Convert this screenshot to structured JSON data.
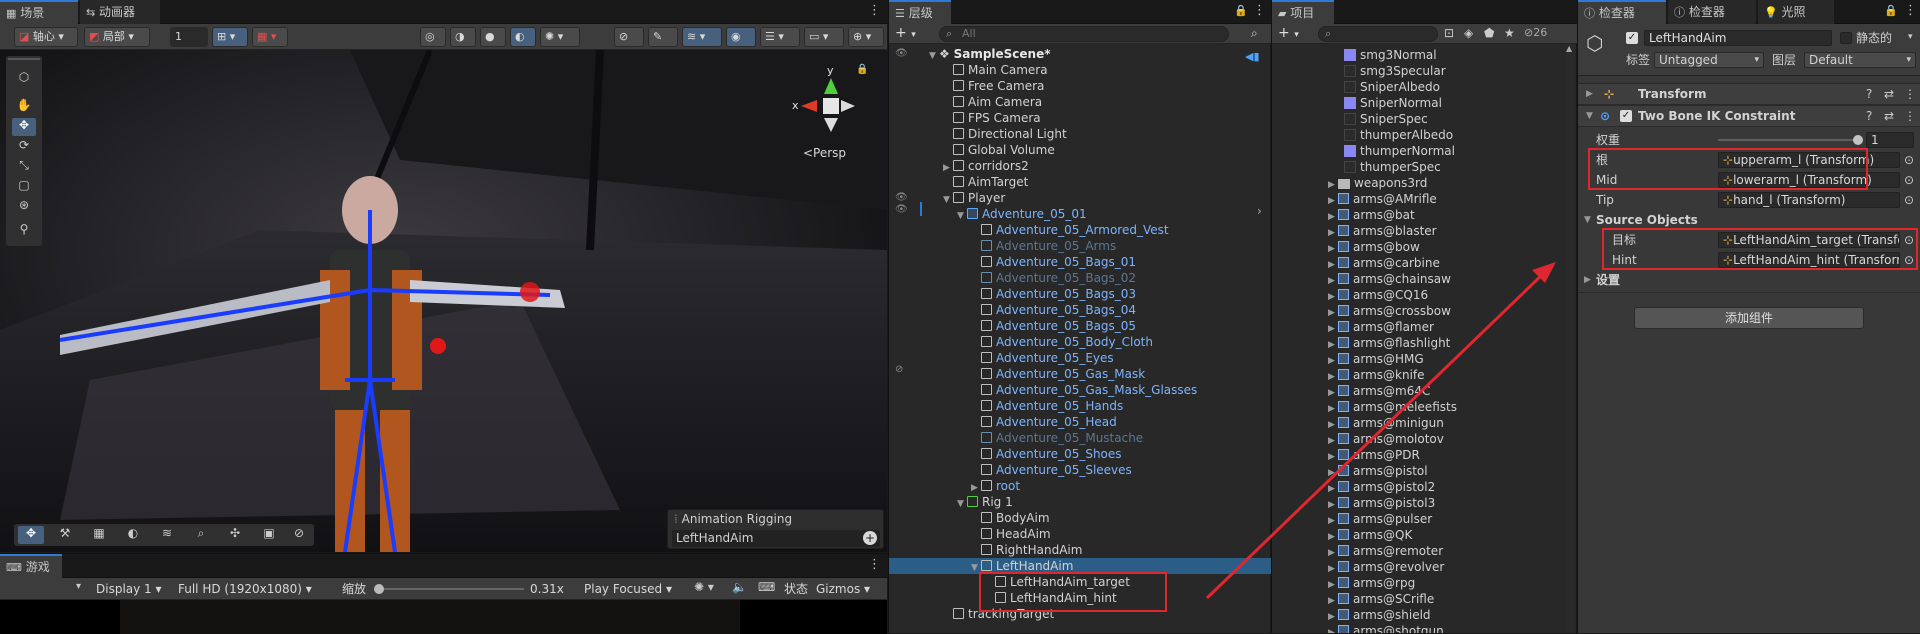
{
  "scene_panel": {
    "tabs": [
      {
        "label": "场景",
        "icon": "scene-grid-icon"
      },
      {
        "label": "动画器",
        "icon": "animator-icon"
      }
    ],
    "toolbar": {
      "pivot_label": "轴心",
      "local_label": "局部",
      "step_value": "1"
    },
    "gizmo": {
      "y_label": "y",
      "x_label": "x",
      "persp_label": "<Persp"
    },
    "overlay": {
      "title": "Animation Rigging",
      "value": "LeftHandAim"
    }
  },
  "game_panel": {
    "tab_label": "游戏",
    "display_label": "Display 1",
    "resolution_label": "Full HD (1920x1080)",
    "scale_label": "缩放",
    "scale_value": "0.31x",
    "play_focus_label": "Play Focused",
    "stats_label": "状态",
    "gizmos_label": "Gizmos"
  },
  "hierarchy": {
    "tab_label": "层级",
    "search_placeholder": "All",
    "rows": [
      {
        "label": "SampleScene*",
        "indent": 0,
        "kind": "scene",
        "arrow": "open"
      },
      {
        "label": "Main Camera",
        "indent": 1,
        "kind": "go"
      },
      {
        "label": "Free Camera",
        "indent": 1,
        "kind": "go"
      },
      {
        "label": "Aim Camera",
        "indent": 1,
        "kind": "go"
      },
      {
        "label": "FPS Camera",
        "indent": 1,
        "kind": "go"
      },
      {
        "label": "Directional Light",
        "indent": 1,
        "kind": "go"
      },
      {
        "label": "Global Volume",
        "indent": 1,
        "kind": "go"
      },
      {
        "label": "corridors2",
        "indent": 1,
        "kind": "go",
        "arrow": "closed"
      },
      {
        "label": "AimTarget",
        "indent": 1,
        "kind": "go"
      },
      {
        "label": "Player",
        "indent": 1,
        "kind": "go",
        "arrow": "open"
      },
      {
        "label": "Adventure_05_01",
        "indent": 2,
        "kind": "prefab",
        "arrow": "open"
      },
      {
        "label": "Adventure_05_Armored_Vest",
        "indent": 3,
        "kind": "prefab-child"
      },
      {
        "label": "Adventure_05_Arms",
        "indent": 3,
        "kind": "prefab-dim"
      },
      {
        "label": "Adventure_05_Bags_01",
        "indent": 3,
        "kind": "prefab-child"
      },
      {
        "label": "Adventure_05_Bags_02",
        "indent": 3,
        "kind": "prefab-dim"
      },
      {
        "label": "Adventure_05_Bags_03",
        "indent": 3,
        "kind": "prefab-child"
      },
      {
        "label": "Adventure_05_Bags_04",
        "indent": 3,
        "kind": "prefab-child"
      },
      {
        "label": "Adventure_05_Bags_05",
        "indent": 3,
        "kind": "prefab-child"
      },
      {
        "label": "Adventure_05_Body_Cloth",
        "indent": 3,
        "kind": "prefab-child"
      },
      {
        "label": "Adventure_05_Eyes",
        "indent": 3,
        "kind": "prefab-child"
      },
      {
        "label": "Adventure_05_Gas_Mask",
        "indent": 3,
        "kind": "prefab-child"
      },
      {
        "label": "Adventure_05_Gas_Mask_Glasses",
        "indent": 3,
        "kind": "prefab-child"
      },
      {
        "label": "Adventure_05_Hands",
        "indent": 3,
        "kind": "prefab-child"
      },
      {
        "label": "Adventure_05_Head",
        "indent": 3,
        "kind": "prefab-child"
      },
      {
        "label": "Adventure_05_Mustache",
        "indent": 3,
        "kind": "prefab-dim"
      },
      {
        "label": "Adventure_05_Shoes",
        "indent": 3,
        "kind": "prefab-child"
      },
      {
        "label": "Adventure_05_Sleeves",
        "indent": 3,
        "kind": "prefab-child"
      },
      {
        "label": "root",
        "indent": 3,
        "kind": "prefab-child",
        "arrow": "closed"
      },
      {
        "label": "Rig 1",
        "indent": 2,
        "kind": "rig",
        "arrow": "open"
      },
      {
        "label": "BodyAim",
        "indent": 3,
        "kind": "go"
      },
      {
        "label": "HeadAim",
        "indent": 3,
        "kind": "go"
      },
      {
        "label": "RightHandAim",
        "indent": 3,
        "kind": "go"
      },
      {
        "label": "LeftHandAim",
        "indent": 3,
        "kind": "go",
        "arrow": "open",
        "selected": true
      },
      {
        "label": "LeftHandAim_target",
        "indent": 4,
        "kind": "go"
      },
      {
        "label": "LeftHandAim_hint",
        "indent": 4,
        "kind": "go"
      },
      {
        "label": "trackingTarget",
        "indent": 1,
        "kind": "go"
      }
    ]
  },
  "project": {
    "tab_label": "项目",
    "count": "26",
    "items": [
      {
        "label": "smg3Normal",
        "kind": "tex-normal"
      },
      {
        "label": "smg3Specular",
        "kind": "tex-dark"
      },
      {
        "label": "SniperAlbedo",
        "kind": "tex-dark"
      },
      {
        "label": "SniperNormal",
        "kind": "tex-normal"
      },
      {
        "label": "SniperSpec",
        "kind": "tex-dark"
      },
      {
        "label": "thumperAlbedo",
        "kind": "tex-dark"
      },
      {
        "label": "thumperNormal",
        "kind": "tex-normal"
      },
      {
        "label": "thumperSpec",
        "kind": "tex-dark"
      },
      {
        "label": "weapons3rd",
        "kind": "folder"
      },
      {
        "label": "arms@AMrifle",
        "kind": "prefab"
      },
      {
        "label": "arms@bat",
        "kind": "prefab"
      },
      {
        "label": "arms@blaster",
        "kind": "prefab"
      },
      {
        "label": "arms@bow",
        "kind": "prefab"
      },
      {
        "label": "arms@carbine",
        "kind": "prefab"
      },
      {
        "label": "arms@chainsaw",
        "kind": "prefab"
      },
      {
        "label": "arms@CQ16",
        "kind": "prefab"
      },
      {
        "label": "arms@crossbow",
        "kind": "prefab"
      },
      {
        "label": "arms@flamer",
        "kind": "prefab"
      },
      {
        "label": "arms@flashlight",
        "kind": "prefab"
      },
      {
        "label": "arms@HMG",
        "kind": "prefab"
      },
      {
        "label": "arms@knife",
        "kind": "prefab"
      },
      {
        "label": "arms@m64C",
        "kind": "prefab"
      },
      {
        "label": "arms@meleefists",
        "kind": "prefab"
      },
      {
        "label": "arms@minigun",
        "kind": "prefab"
      },
      {
        "label": "arms@molotov",
        "kind": "prefab"
      },
      {
        "label": "arms@PDR",
        "kind": "prefab"
      },
      {
        "label": "arms@pistol",
        "kind": "prefab"
      },
      {
        "label": "arms@pistol2",
        "kind": "prefab"
      },
      {
        "label": "arms@pistol3",
        "kind": "prefab"
      },
      {
        "label": "arms@pulser",
        "kind": "prefab"
      },
      {
        "label": "arms@QK",
        "kind": "prefab"
      },
      {
        "label": "arms@remoter",
        "kind": "prefab"
      },
      {
        "label": "arms@revolver",
        "kind": "prefab"
      },
      {
        "label": "arms@rpg",
        "kind": "prefab"
      },
      {
        "label": "arms@SCrifle",
        "kind": "prefab"
      },
      {
        "label": "arms@shield",
        "kind": "prefab"
      },
      {
        "label": "arms@shotgun",
        "kind": "prefab"
      }
    ]
  },
  "inspector": {
    "tabs": [
      {
        "label": "检查器",
        "icon": "info-icon"
      },
      {
        "label": "检查器",
        "icon": "info-icon"
      },
      {
        "label": "光照",
        "icon": "light-icon"
      }
    ],
    "object_name": "LeftHandAim",
    "static_label": "静态的",
    "tag_label": "标签",
    "tag_value": "Untagged",
    "layer_label": "图层",
    "layer_value": "Default",
    "transform_label": "Transform",
    "component_label": "Two Bone IK Constraint",
    "weight_label": "权重",
    "weight_value": "1",
    "weight_fraction": 1.0,
    "root_label": "根",
    "root_value": "upperarm_l (Transform)",
    "mid_label": "Mid",
    "mid_value": "lowerarm_l (Transform)",
    "tip_label": "Tip",
    "tip_value": "hand_l (Transform)",
    "source_objects_label": "Source Objects",
    "target_label": "目标",
    "target_value": "LeftHandAim_target (Transform)",
    "hint_label": "Hint",
    "hint_value": "LeftHandAim_hint (Transform)",
    "settings_label": "设置",
    "add_component_label": "添加组件"
  },
  "colors": {
    "accent": "#2d7bd6",
    "selection": "#2c5d87",
    "prefab": "#7cb4ff",
    "annotation": "#e0262f"
  }
}
